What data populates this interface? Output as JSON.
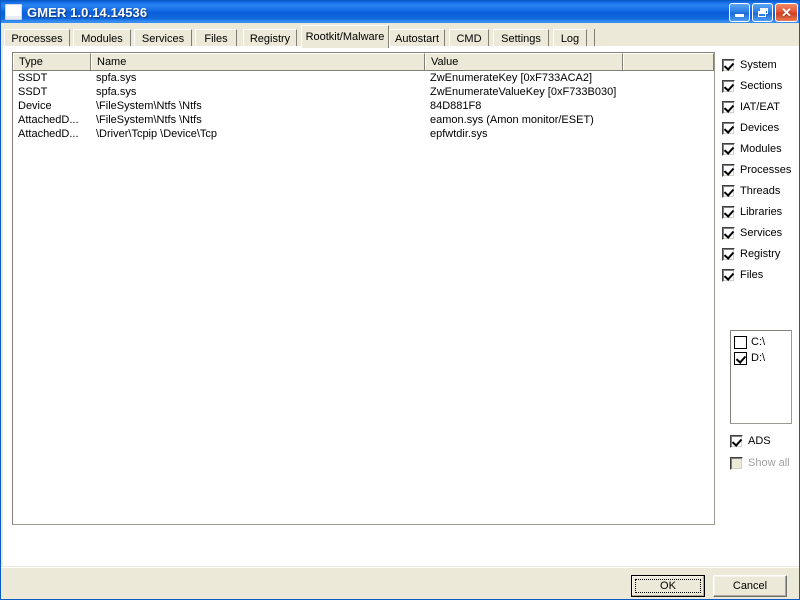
{
  "window": {
    "title": "GMER 1.0.14.14536",
    "icon": "app-icon",
    "minimize_label": "Minimize",
    "restore_label": "Restore",
    "close_label": "Close"
  },
  "tabs": [
    {
      "label": "Processes",
      "selected": false
    },
    {
      "label": "Modules",
      "selected": false
    },
    {
      "label": "Services",
      "selected": false
    },
    {
      "label": "Files",
      "selected": false
    },
    {
      "label": "Registry",
      "selected": false
    },
    {
      "label": "Rootkit/Malware",
      "selected": true
    },
    {
      "label": "Autostart",
      "selected": false
    },
    {
      "label": "CMD",
      "selected": false
    },
    {
      "label": "Settings",
      "selected": false
    },
    {
      "label": "Log",
      "selected": false
    }
  ],
  "listview": {
    "columns": [
      {
        "label": "Type"
      },
      {
        "label": "Name"
      },
      {
        "label": "Value"
      },
      {
        "label": ""
      }
    ],
    "rows": [
      {
        "type": "SSDT",
        "name": "spfa.sys",
        "value": "ZwEnumerateKey [0xF733ACA2]"
      },
      {
        "type": "SSDT",
        "name": "spfa.sys",
        "value": "ZwEnumerateValueKey [0xF733B030]"
      },
      {
        "type": "Device",
        "name": "\\FileSystem\\Ntfs \\Ntfs",
        "value": "84D881F8"
      },
      {
        "type": "AttachedD...",
        "name": "\\FileSystem\\Ntfs \\Ntfs",
        "value": "eamon.sys (Amon monitor/ESET)"
      },
      {
        "type": "AttachedD...",
        "name": "\\Driver\\Tcpip \\Device\\Tcp",
        "value": "epfwtdir.sys"
      }
    ]
  },
  "options": {
    "checkboxes": [
      {
        "label": "System",
        "checked": true,
        "enabled": true
      },
      {
        "label": "Sections",
        "checked": true,
        "enabled": true
      },
      {
        "label": "IAT/EAT",
        "checked": true,
        "enabled": true
      },
      {
        "label": "Devices",
        "checked": true,
        "enabled": true
      },
      {
        "label": "Modules",
        "checked": true,
        "enabled": true
      },
      {
        "label": "Processes",
        "checked": true,
        "enabled": true
      },
      {
        "label": "Threads",
        "checked": true,
        "enabled": true
      },
      {
        "label": "Libraries",
        "checked": true,
        "enabled": true
      },
      {
        "label": "Services",
        "checked": true,
        "enabled": true
      },
      {
        "label": "Registry",
        "checked": true,
        "enabled": true
      },
      {
        "label": "Files",
        "checked": true,
        "enabled": true
      }
    ],
    "drives": [
      {
        "label": "C:\\",
        "checked": false
      },
      {
        "label": "D:\\",
        "checked": true
      }
    ],
    "ads": {
      "label": "ADS",
      "checked": true,
      "enabled": true
    },
    "show_all": {
      "label": "Show all",
      "checked": false,
      "enabled": false
    }
  },
  "buttons": {
    "ok": {
      "label": "OK",
      "default": true
    },
    "cancel": {
      "label": "Cancel",
      "default": false
    }
  },
  "colors": {
    "title_active": "#0a5bc4",
    "face": "#ece9d8",
    "field": "#ffffff",
    "border": "#7f7f76",
    "disabled_text": "#a0a0a0"
  }
}
